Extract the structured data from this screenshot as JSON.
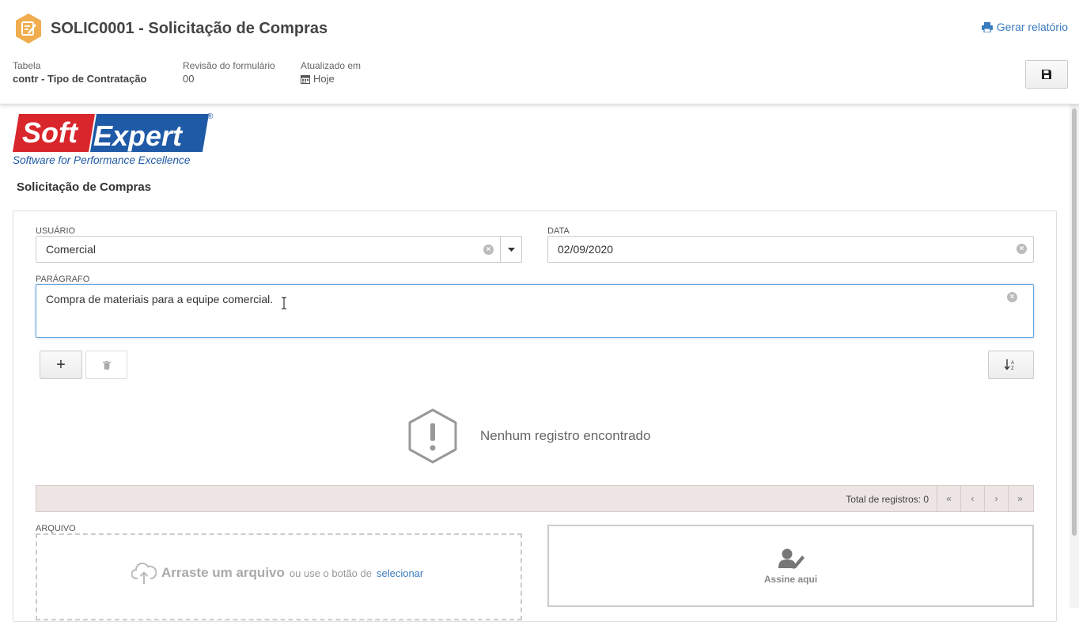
{
  "header": {
    "title": "SOLIC0001 - Solicitação de Compras",
    "report_link": "Gerar relatório",
    "meta": {
      "table_label": "Tabela",
      "table_value": "contr - Tipo de Contratação",
      "revision_label": "Revisão do formulário",
      "revision_value": "00",
      "updated_label": "Atualizado em",
      "updated_value": "Hoje"
    }
  },
  "logo": {
    "soft": "Soft",
    "expert": "Expert",
    "tagline": "Software for Performance Excellence",
    "registered": "®"
  },
  "form": {
    "section_title": "Solicitação de Compras",
    "usuario_label": "USUÁRIO",
    "usuario_value": "Comercial",
    "data_label": "DATA",
    "data_value": "02/09/2020",
    "paragrafo_label": "PARÁGRAFO",
    "paragrafo_value": "Compra de materiais para a equipe comercial.",
    "empty_message": "Nenhum registro encontrado",
    "total_label": "Total de registros: 0",
    "pager": {
      "first": "«",
      "prev": "‹",
      "next": "›",
      "last": "»"
    },
    "arquivo_label": "ARQUIVO",
    "drop_main": "Arraste um arquivo",
    "drop_sub": "ou use o botão de",
    "drop_link": "selecionar",
    "sign_label": "Assine aqui",
    "add_symbol": "+"
  },
  "colors": {
    "accent": "#3a7bbf",
    "hex_icon": "#f0ad4e",
    "logo_red": "#d9262c",
    "logo_blue": "#1f5aa6"
  }
}
